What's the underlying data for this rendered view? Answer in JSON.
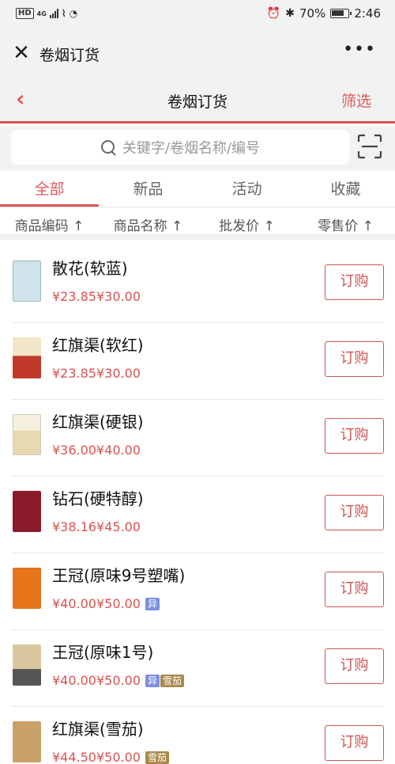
{
  "status": {
    "network": "HD",
    "net_type": "4G",
    "battery_percent": "70%",
    "time": "2:46"
  },
  "wechat": {
    "title": "卷烟订货",
    "more": "•••"
  },
  "header": {
    "back_icon": "chevron-left-icon",
    "title": "卷烟订货",
    "filter_label": "筛选"
  },
  "search": {
    "placeholder": "关键字/卷烟名称/编号",
    "scan_icon": "scan-icon"
  },
  "tabs": [
    {
      "label": "全部",
      "active": true
    },
    {
      "label": "新品",
      "active": false
    },
    {
      "label": "活动",
      "active": false
    },
    {
      "label": "收藏",
      "active": false
    }
  ],
  "sort": [
    {
      "label": "商品编码 ↑"
    },
    {
      "label": "商品名称 ↑"
    },
    {
      "label": "批发价 ↑"
    },
    {
      "label": "零售价 ↑"
    }
  ],
  "products": [
    {
      "name": "散花(软蓝)",
      "wholesale": "¥23.85",
      "retail": "¥30.00",
      "badges": [],
      "order_label": "订购",
      "thumb_color": "#cfe3ea"
    },
    {
      "name": "红旗渠(软红)",
      "wholesale": "¥23.85",
      "retail": "¥30.00",
      "badges": [],
      "order_label": "订购",
      "thumb_color": "#c0392b"
    },
    {
      "name": "红旗渠(硬银)",
      "wholesale": "¥36.00",
      "retail": "¥40.00",
      "badges": [],
      "order_label": "订购",
      "thumb_color": "#e8d9b0"
    },
    {
      "name": "钻石(硬特醇)",
      "wholesale": "¥38.16",
      "retail": "¥45.00",
      "badges": [],
      "order_label": "订购",
      "thumb_color": "#8b1a2b"
    },
    {
      "name": "王冠(原味9号塑嘴)",
      "wholesale": "¥40.00",
      "retail": "¥50.00",
      "badges": [
        "异"
      ],
      "order_label": "订购",
      "thumb_color": "#e8741c"
    },
    {
      "name": "王冠(原味1号)",
      "wholesale": "¥40.00",
      "retail": "¥50.00",
      "badges": [
        "异",
        "雪茄"
      ],
      "order_label": "订购",
      "thumb_color": "#d9c7a0"
    },
    {
      "name": "红旗渠(雪茄)",
      "wholesale": "¥44.50",
      "retail": "¥50.00",
      "badges": [
        "雪茄"
      ],
      "order_label": "订购",
      "thumb_color": "#c9a06a"
    }
  ],
  "colors": {
    "accent": "#e05a5a",
    "price": "#d9534f",
    "badge_yi": "#7b8fe0",
    "badge_xuejia": "#a88a4a"
  }
}
